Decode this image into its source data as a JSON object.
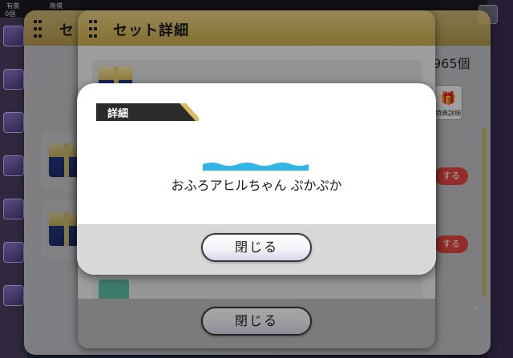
{
  "background": {
    "topbar": {
      "label_paid": "有償",
      "label_free": "無償",
      "paid_count": "0個"
    }
  },
  "back_panel": {
    "title": "セ"
  },
  "set_panel": {
    "title": "セット詳細",
    "close_label": "閉じる"
  },
  "side_right": {
    "count": "965個",
    "shop_label": "特典詳細",
    "buy_label": "する"
  },
  "detail_dialog": {
    "tag_label": "詳細",
    "item_name": "おふろアヒルちゃん ぷかぷか",
    "close_label": "閉じる"
  },
  "colors": {
    "header_gold": "#d8bb62",
    "tag_dark": "#2b2b2b",
    "wave_blue": "#2fb6e6",
    "buy_red": "#e0463f"
  }
}
